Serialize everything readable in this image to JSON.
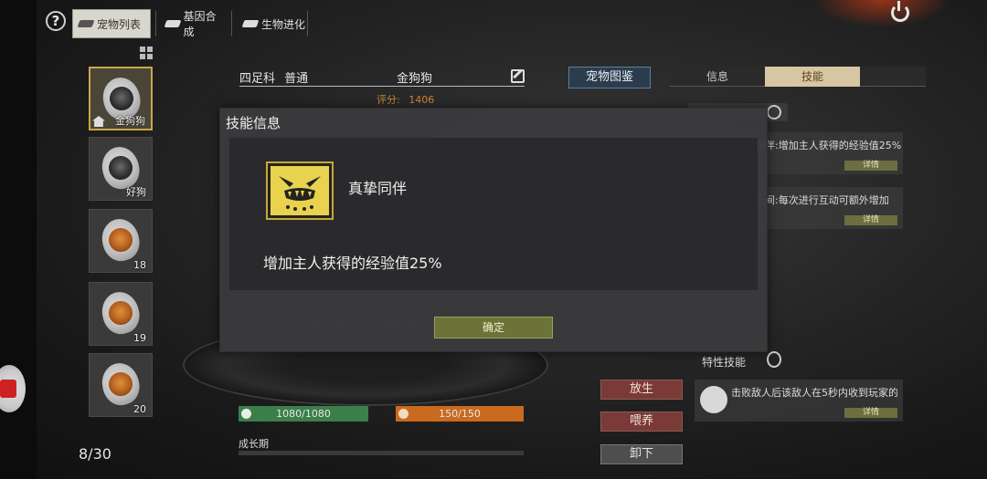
{
  "top_tabs": [
    {
      "label": "宠物列表",
      "active": true
    },
    {
      "label": "基因合成",
      "active": false
    },
    {
      "label": "生物进化",
      "active": false
    }
  ],
  "help_label": "?",
  "pets": [
    {
      "name": "金狗狗",
      "selected": true
    },
    {
      "name": "好狗",
      "selected": false
    },
    {
      "name": "18",
      "selected": false
    },
    {
      "name": "19",
      "selected": false
    },
    {
      "name": "20",
      "selected": false
    }
  ],
  "pet_count": "8/30",
  "pet_header": {
    "family": "四足科",
    "rarity": "普通",
    "name": "金狗狗",
    "score_label": "评分:",
    "score_value": "1406"
  },
  "dex_button": "宠物图鉴",
  "right_tabs": [
    {
      "label": "信息",
      "active": false
    },
    {
      "label": "技能",
      "active": true
    }
  ],
  "right_skills": [
    {
      "text": "真挚同伴:增加主人获得的经验值25%",
      "detail": "详情"
    },
    {
      "text": "亲密无间:每次进行互动可额外增加",
      "detail": "详情"
    }
  ],
  "trait_label": "特性技能",
  "trait_skill": {
    "text": "击败敌人后该敌人在5秒内收到玩家的",
    "detail": "详情"
  },
  "stats": {
    "hp": "1080/1080",
    "food": "150/150",
    "growth_label": "成长期"
  },
  "actions": [
    "放生",
    "喂养",
    "卸下"
  ],
  "modal": {
    "title": "技能信息",
    "skill_name": "真挚同伴",
    "skill_desc": "增加主人获得的经验值25%",
    "ok_label": "确定"
  },
  "colors": {
    "accent_gold": "#c9a64a",
    "hp_green": "#3b7f4a",
    "food_orange": "#c96a1e",
    "ok_olive": "#6b7338",
    "action_red": "#7a3a36"
  }
}
